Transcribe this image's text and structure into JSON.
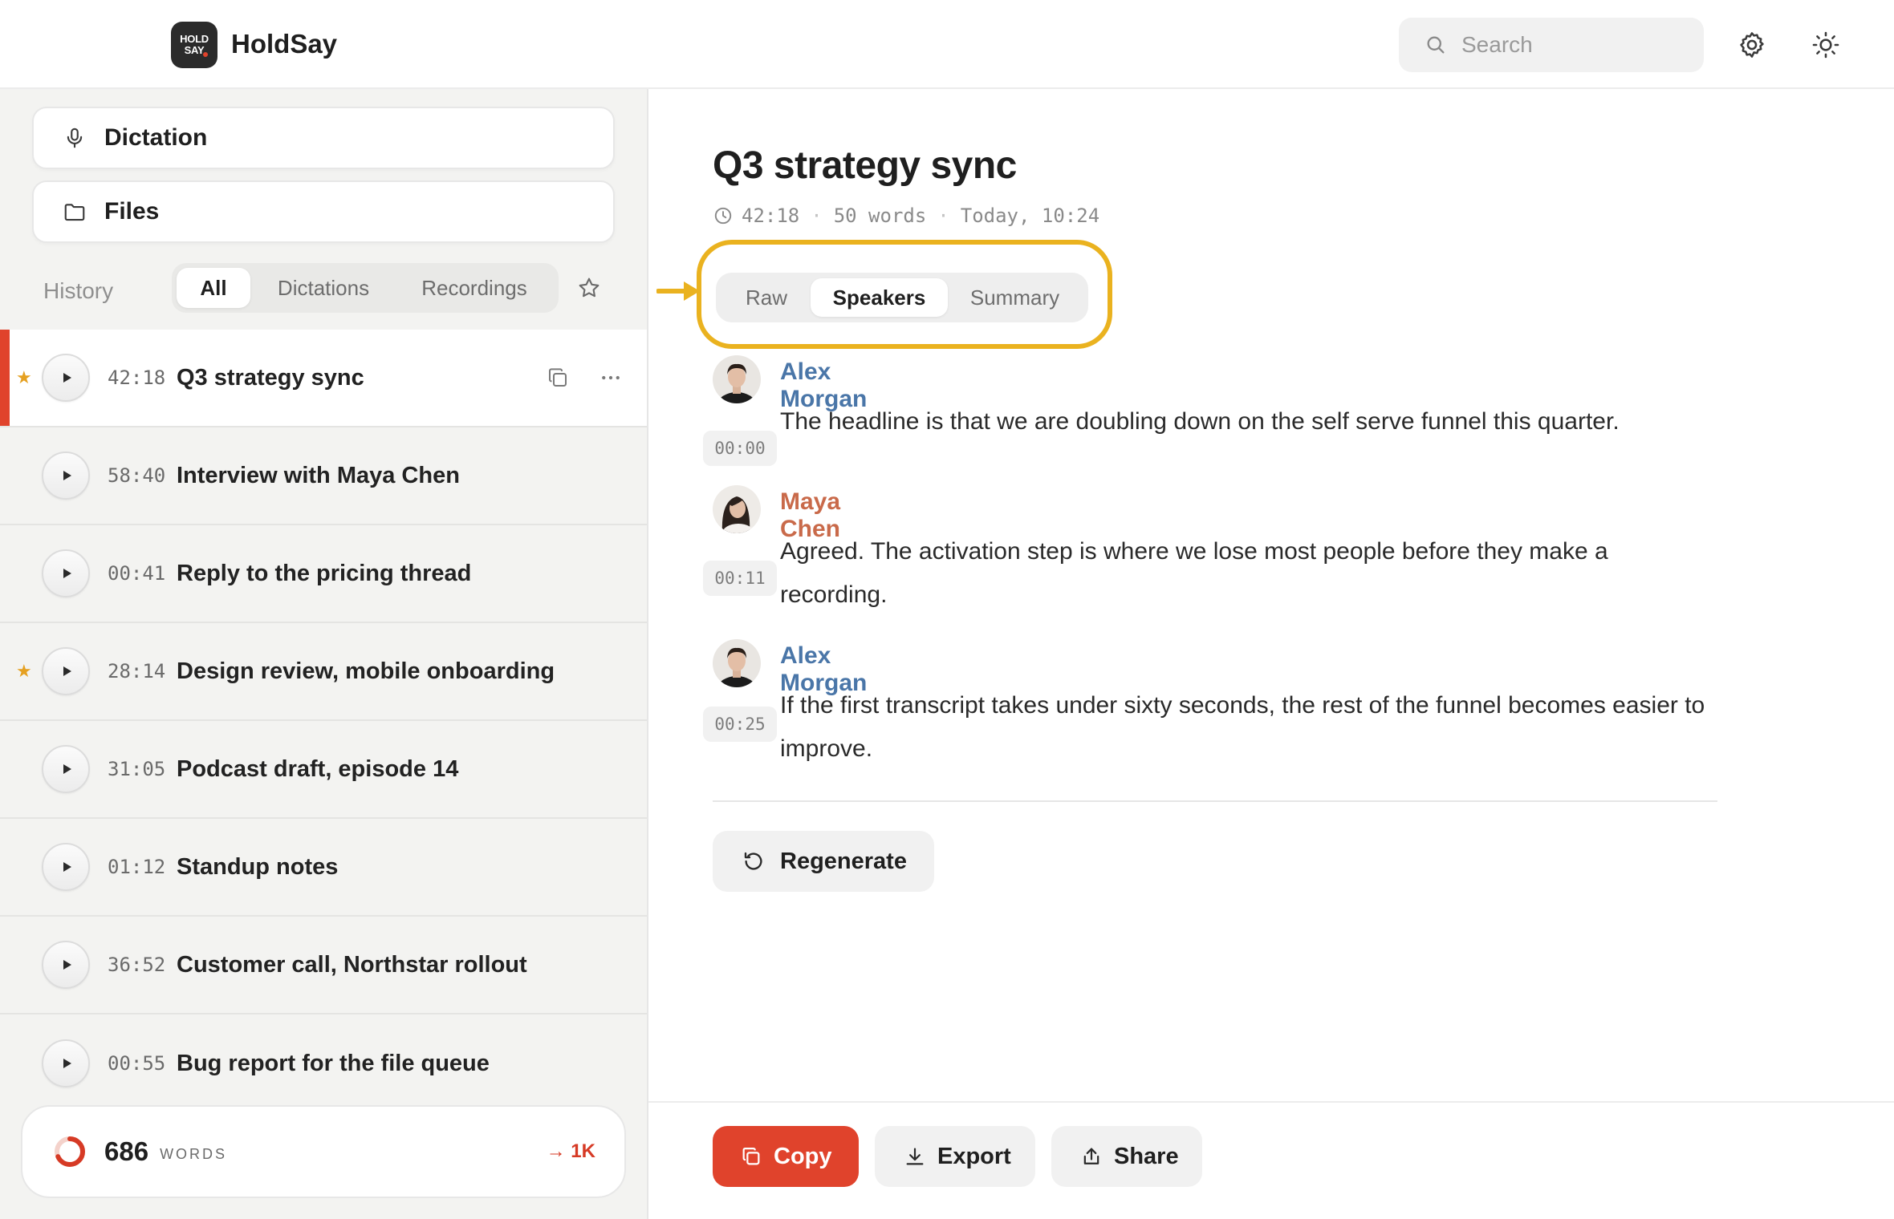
{
  "app": {
    "name": "HoldSay",
    "logo_line1": "HOLD",
    "logo_line2": "SAY"
  },
  "search": {
    "placeholder": "Search"
  },
  "sidebar": {
    "nav": [
      {
        "label": "Dictation",
        "icon": "microphone-icon"
      },
      {
        "label": "Files",
        "icon": "folder-icon"
      }
    ],
    "history_label": "History",
    "filters": [
      "All",
      "Dictations",
      "Recordings"
    ],
    "active_filter": "All",
    "items": [
      {
        "duration": "42:18",
        "title": "Q3 strategy sync",
        "starred": true,
        "active": true
      },
      {
        "duration": "58:40",
        "title": "Interview with Maya Chen",
        "starred": false
      },
      {
        "duration": "00:41",
        "title": "Reply to the pricing thread",
        "starred": false
      },
      {
        "duration": "28:14",
        "title": "Design review, mobile onboarding",
        "starred": true
      },
      {
        "duration": "31:05",
        "title": "Podcast draft, episode 14",
        "starred": false
      },
      {
        "duration": "01:12",
        "title": "Standup notes",
        "starred": false
      },
      {
        "duration": "36:52",
        "title": "Customer call, Northstar rollout",
        "starred": false
      },
      {
        "duration": "00:55",
        "title": "Bug report for the file queue",
        "starred": false
      }
    ],
    "words": {
      "count": "686",
      "label": "WORDS",
      "goal": "→ 1K",
      "progress_fraction": 0.686
    }
  },
  "document": {
    "title": "Q3 strategy sync",
    "duration": "42:18",
    "words": "50 words",
    "time": "Today, 10:24",
    "tabs": [
      "Raw",
      "Speakers",
      "Summary"
    ],
    "active_tab": "Speakers",
    "utterances": [
      {
        "speaker": "Alex Morgan",
        "time": "00:00",
        "text": "The headline is that we are doubling down on the self serve funnel this quarter."
      },
      {
        "speaker": "Maya Chen",
        "time": "00:11",
        "text": "Agreed. The activation step is where we lose most people before they make a recording."
      },
      {
        "speaker": "Alex Morgan",
        "time": "00:25",
        "text": "If the first transcript takes under sixty seconds, the rest of the funnel becomes easier to improve."
      }
    ],
    "regenerate_label": "Regenerate"
  },
  "actions": {
    "copy": "Copy",
    "export": "Export",
    "share": "Share"
  },
  "colors": {
    "accent": "#e0432c",
    "highlight": "#eab21f",
    "speaker_alex": "#4a76a8",
    "speaker_maya": "#c96a4a",
    "star": "#e5a021"
  }
}
